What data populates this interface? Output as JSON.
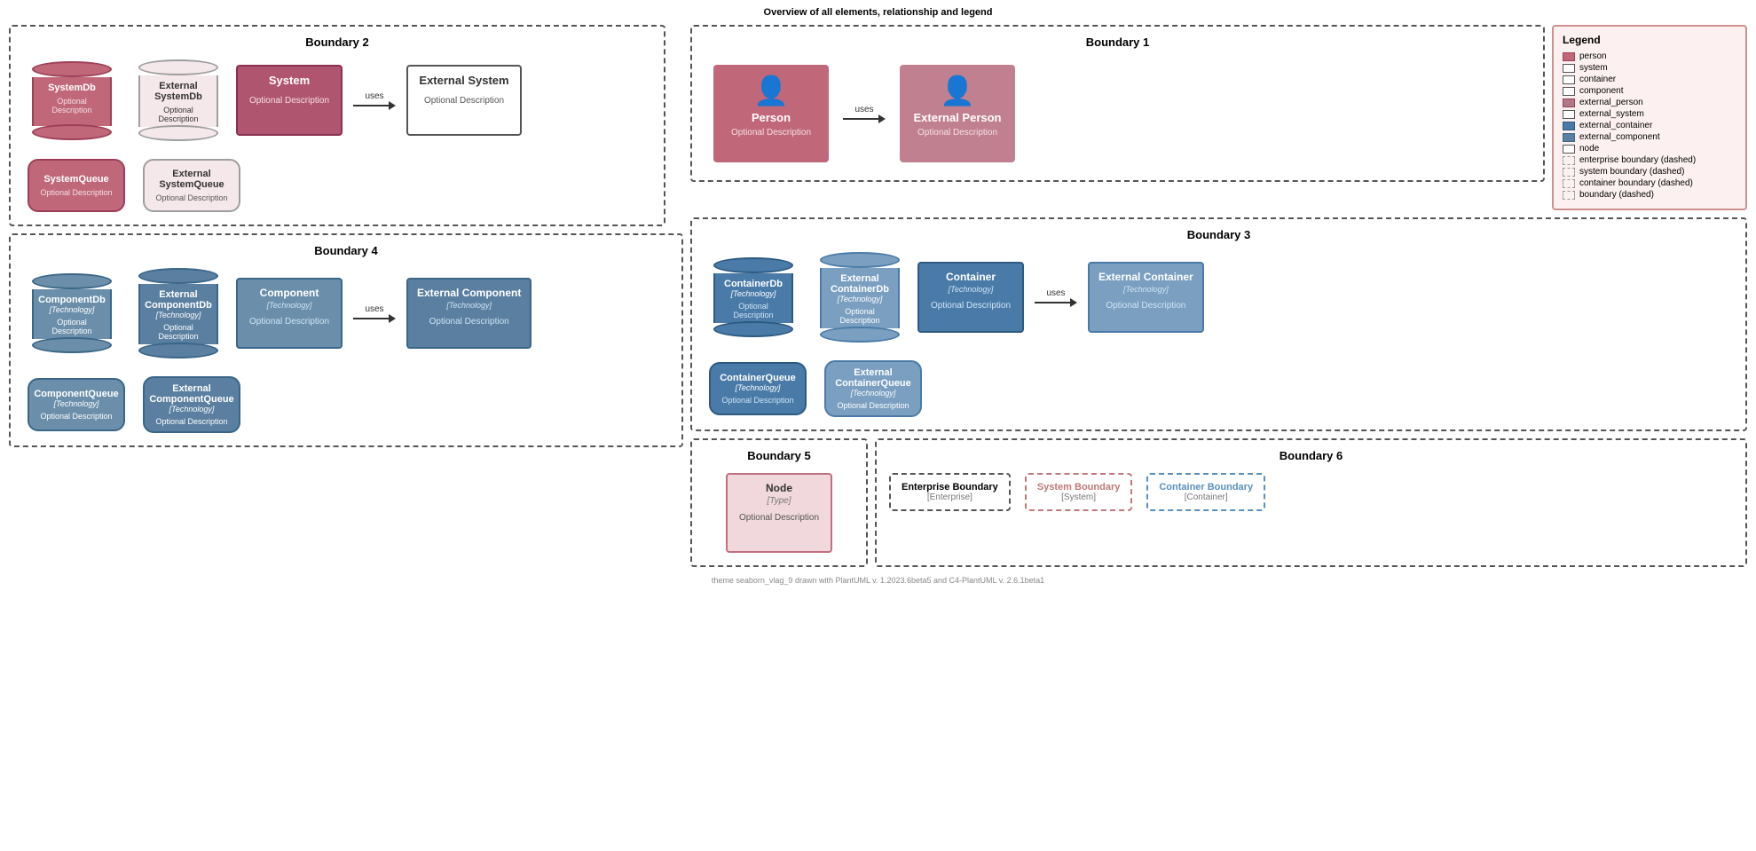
{
  "title": "Overview of all elements, relationship and legend",
  "footer": "theme seaborn_vlag_9 drawn with PlantUML v. 1.2023.6beta5 and C4-PlantUML v. 2.6.1beta1",
  "legend": {
    "title": "Legend",
    "items": [
      {
        "label": "person",
        "type": "person"
      },
      {
        "label": "system",
        "type": "system"
      },
      {
        "label": "container",
        "type": "container"
      },
      {
        "label": "component",
        "type": "component"
      },
      {
        "label": "external_person",
        "type": "ext-person"
      },
      {
        "label": "external_system",
        "type": "ext-system"
      },
      {
        "label": "external_container",
        "type": "ext-container"
      },
      {
        "label": "external_component",
        "type": "ext-component"
      },
      {
        "label": "node",
        "type": "node"
      },
      {
        "label": "enterprise boundary (dashed)",
        "type": "dashed"
      },
      {
        "label": "system boundary (dashed)",
        "type": "dashed"
      },
      {
        "label": "container boundary (dashed)",
        "type": "dashed"
      },
      {
        "label": "boundary (dashed)",
        "type": "dashed"
      }
    ]
  },
  "boundary2": {
    "title": "Boundary 2",
    "row1": {
      "items": [
        {
          "id": "systemdb",
          "shape": "cylinder",
          "name": "SystemDb",
          "desc": "Optional Description",
          "type": "system"
        },
        {
          "id": "ext-systemdb",
          "shape": "cylinder",
          "name": "External SystemDb",
          "desc": "Optional Description",
          "type": "external-system"
        },
        {
          "id": "system",
          "shape": "box",
          "name": "System",
          "desc": "Optional Description",
          "type": "system"
        },
        {
          "arrow": true,
          "label": "uses"
        },
        {
          "id": "ext-system",
          "shape": "box",
          "name": "External System",
          "desc": "Optional Description",
          "type": "external-system"
        }
      ]
    },
    "row2": {
      "items": [
        {
          "id": "systemqueue",
          "shape": "queue",
          "name": "SystemQueue",
          "desc": "Optional Description",
          "type": "system"
        },
        {
          "id": "ext-systemqueue",
          "shape": "queue",
          "name": "External SystemQueue",
          "desc": "Optional Description",
          "type": "external-system"
        }
      ]
    }
  },
  "boundary1": {
    "title": "Boundary 1",
    "person": {
      "name": "Person",
      "desc": "Optional Description",
      "type": "internal"
    },
    "ext_person": {
      "name": "External Person",
      "desc": "Optional Description",
      "type": "external"
    },
    "arrow_label": "uses"
  },
  "boundary3": {
    "title": "Boundary 3",
    "row1": {
      "items": [
        {
          "id": "containerdb",
          "shape": "cylinder",
          "name": "ContainerDb",
          "tech": "[Technology]",
          "desc": "Optional Description",
          "type": "container"
        },
        {
          "id": "ext-containerdb",
          "shape": "cylinder",
          "name": "External ContainerDb",
          "tech": "[Technology]",
          "desc": "Optional Description",
          "type": "external-container"
        },
        {
          "id": "container",
          "shape": "box",
          "name": "Container",
          "tech": "[Technology]",
          "desc": "Optional Description",
          "type": "container"
        },
        {
          "arrow": true,
          "label": "uses"
        },
        {
          "id": "ext-container",
          "shape": "box",
          "name": "External Container",
          "tech": "[Technology]",
          "desc": "Optional Description",
          "type": "external-container"
        }
      ]
    },
    "row2": {
      "items": [
        {
          "id": "containerqueue",
          "shape": "queue",
          "name": "ContainerQueue",
          "tech": "[Technology]",
          "desc": "Optional Description",
          "type": "container"
        },
        {
          "id": "ext-containerqueue",
          "shape": "queue",
          "name": "External ContainerQueue",
          "tech": "[Technology]",
          "desc": "Optional Description",
          "type": "external-container"
        }
      ]
    }
  },
  "boundary4": {
    "title": "Boundary 4",
    "row1": {
      "items": [
        {
          "id": "componentdb",
          "shape": "cylinder",
          "name": "ComponentDb",
          "tech": "[Technology]",
          "desc": "Optional Description",
          "type": "component"
        },
        {
          "id": "ext-componentdb",
          "shape": "cylinder",
          "name": "External ComponentDb",
          "tech": "[Technology]",
          "desc": "Optional Description",
          "type": "external-component"
        },
        {
          "id": "component",
          "shape": "box",
          "name": "Component",
          "tech": "[Technology]",
          "desc": "Optional Description",
          "type": "component"
        },
        {
          "arrow": true,
          "label": "uses"
        },
        {
          "id": "ext-component",
          "shape": "box",
          "name": "External Component",
          "tech": "[Technology]",
          "desc": "Optional Description",
          "type": "external-component"
        }
      ]
    },
    "row2": {
      "items": [
        {
          "id": "componentqueue",
          "shape": "queue",
          "name": "ComponentQueue",
          "tech": "[Technology]",
          "desc": "Optional Description",
          "type": "component"
        },
        {
          "id": "ext-componentqueue",
          "shape": "queue",
          "name": "External ComponentQueue",
          "tech": "[Technology]",
          "desc": "Optional Description",
          "type": "external-component"
        }
      ]
    }
  },
  "boundary5": {
    "title": "Boundary 5",
    "node": {
      "name": "Node",
      "type": "[Type]",
      "desc": "Optional Description"
    }
  },
  "boundary6": {
    "title": "Boundary 6",
    "sub_boundaries": [
      {
        "name": "Enterprise Boundary",
        "type": "[Enterprise]",
        "style": "enterprise"
      },
      {
        "name": "System Boundary",
        "type": "[System]",
        "style": "system"
      },
      {
        "name": "Container Boundary",
        "type": "[Container]",
        "style": "container"
      }
    ]
  }
}
